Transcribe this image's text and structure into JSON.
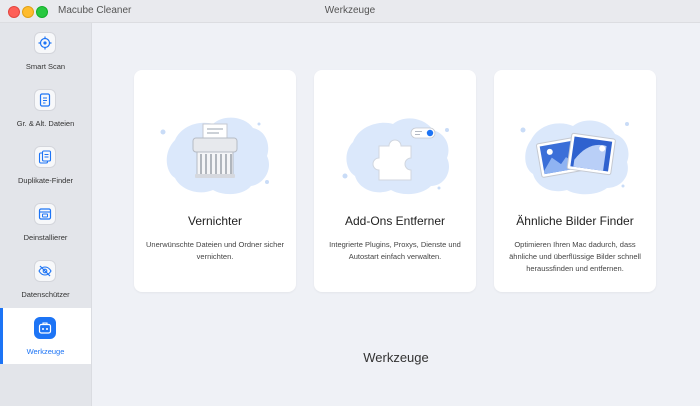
{
  "window": {
    "app_name": "Macube Cleaner",
    "title": "Werkzeuge"
  },
  "sidebar": {
    "items": [
      {
        "label": "Smart Scan",
        "icon": "target-icon"
      },
      {
        "label": "Gr. & Alt. Dateien",
        "icon": "document-icon"
      },
      {
        "label": "Duplikate-Finder",
        "icon": "duplicate-icon"
      },
      {
        "label": "Deinstallierer",
        "icon": "app-icon"
      },
      {
        "label": "Datenschützer",
        "icon": "eye-slash-icon"
      },
      {
        "label": "Werkzeuge",
        "icon": "toolbox-icon",
        "active": true
      }
    ]
  },
  "cards": [
    {
      "title": "Vernichter",
      "description": "Unerwünschte Dateien und Ordner sicher vernichten.",
      "icon": "shredder-icon"
    },
    {
      "title": "Add-Ons Entferner",
      "description": "Integrierte Plugins, Proxys, Dienste und Autostart einfach verwalten.",
      "icon": "puzzle-toggle-icon"
    },
    {
      "title": "Ähnliche Bilder Finder",
      "description": "Optimieren Ihren Mac dadurch, dass ähnliche und überflüssige Bilder schnell heraussfinden und entfernen.",
      "icon": "photos-icon"
    }
  ],
  "main": {
    "heading": "Werkzeuge"
  },
  "colors": {
    "accent": "#1d74f5",
    "blob": "#dbe8fb"
  }
}
